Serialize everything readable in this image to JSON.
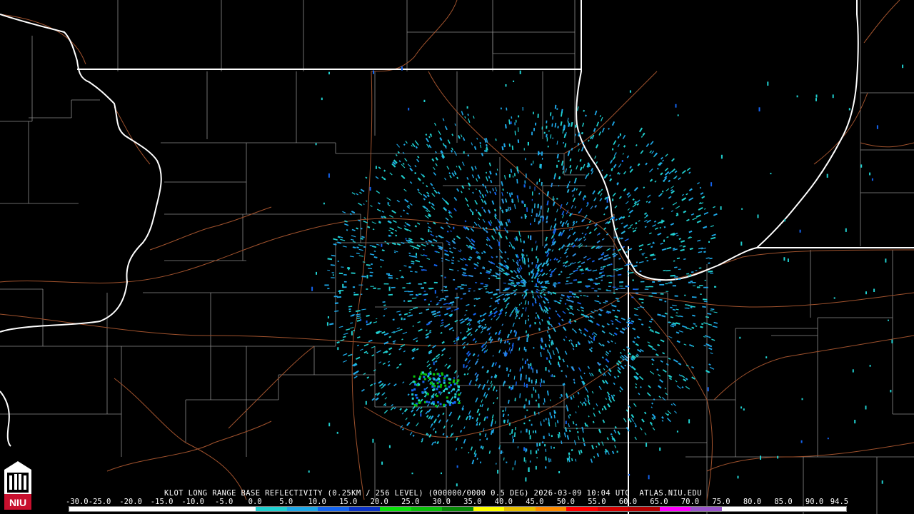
{
  "product": {
    "station": "KLOT",
    "title_line": "KLOT LONG RANGE BASE REFLECTIVITY (0.25KM / 256 LEVEL) (000000/0000 0.5 DEG) 2026-03-09 10:04 UTC  ATLAS.NIU.EDU",
    "datetime": "2026-03-09 10:04 UTC",
    "source": "ATLAS.NIU.EDU",
    "elevation": "0.5 DEG"
  },
  "logo": {
    "text": "NIU",
    "icon": "castle-icon",
    "colors": {
      "top": "#ffffff",
      "bottom": "#c8102e"
    }
  },
  "colorbar": {
    "ticks": [
      "-30.0",
      "-25.0",
      "-20.0",
      "-15.0",
      "-10.0",
      "-5.0",
      "0.0",
      "5.0",
      "10.0",
      "15.0",
      "20.0",
      "25.0",
      "30.0",
      "35.0",
      "40.0",
      "45.0",
      "50.0",
      "55.0",
      "60.0",
      "65.0",
      "70.0",
      "75.0",
      "80.0",
      "85.0",
      "90.0",
      "94.5"
    ],
    "colors": [
      "#ffffff",
      "#ffffff",
      "#ffffff",
      "#ffffff",
      "#ffffff",
      "#ffffff",
      "#20d0d0",
      "#1ea8e8",
      "#1464f0",
      "#0a32c8",
      "#0ae00a",
      "#0ac00a",
      "#078a07",
      "#ffff00",
      "#e8c000",
      "#ff8c00",
      "#ff0000",
      "#d40000",
      "#b40000",
      "#ff00ff",
      "#9955cc",
      "#ffffff",
      "#ffffff",
      "#ffffff",
      "#ffffff"
    ]
  },
  "map": {
    "state_border_color": "#ffffff",
    "county_line_color": "#8c8c8c",
    "highway_color": "#a0522d",
    "radar_site": "KLOT"
  }
}
